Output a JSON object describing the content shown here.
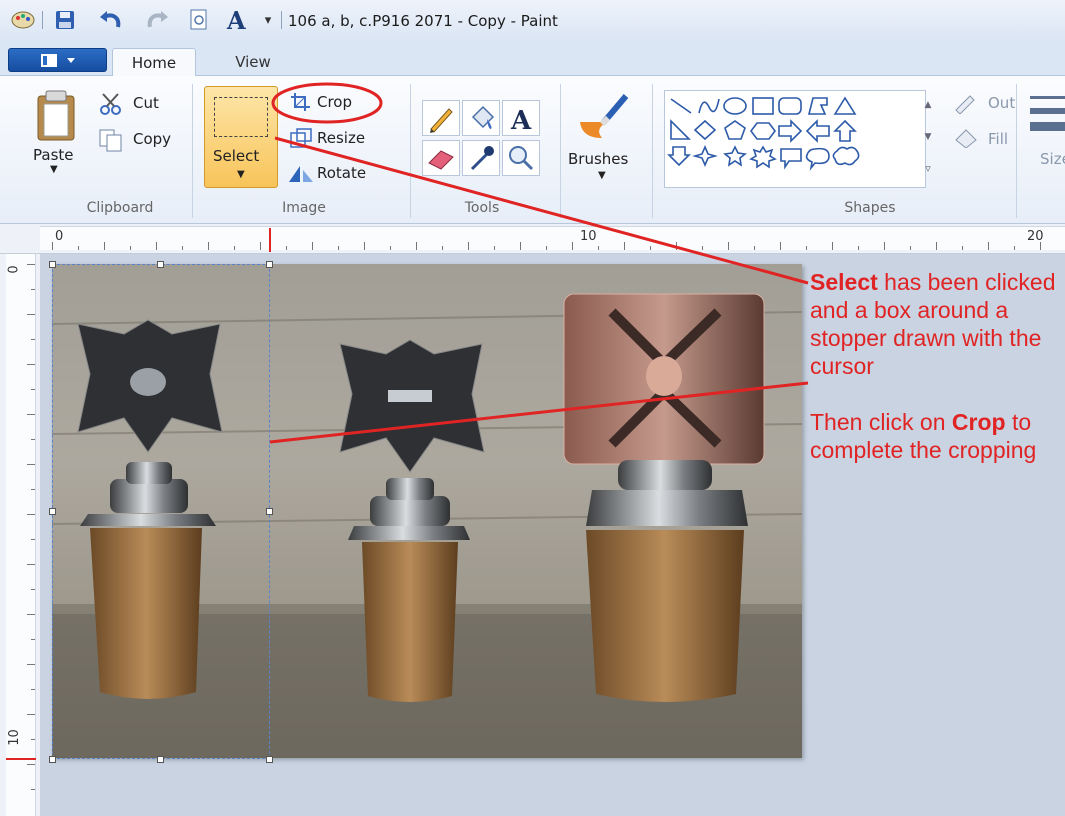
{
  "window": {
    "title": "106 a, b, c.P916 2071 - Copy - Paint"
  },
  "tabs": [
    {
      "label": "Home"
    },
    {
      "label": "View"
    }
  ],
  "clipboard": {
    "paste": "Paste",
    "cut": "Cut",
    "copy": "Copy",
    "group": "Clipboard"
  },
  "image": {
    "select": "Select",
    "crop": "Crop",
    "resize": "Resize",
    "rotate": "Rotate",
    "group": "Image"
  },
  "tools": {
    "group": "Tools"
  },
  "brushes": {
    "label": "Brushes"
  },
  "shapes": {
    "group": "Shapes",
    "outline": "Out",
    "fill": "Fill"
  },
  "size": {
    "label": "Size"
  },
  "ruler": {
    "h_labels": [
      "0",
      "10",
      "20"
    ],
    "v_labels": [
      "0",
      "10"
    ]
  },
  "annotation": {
    "line1_bold": "Select",
    "line1_rest": " has been clicked and a box around a stopper drawn with the cursor",
    "line2_pre": "Then click on ",
    "line2_bold": "Crop",
    "line2_rest": " to complete the cropping"
  },
  "colors": {
    "annotation": "#e02424",
    "ribbon_bg": "#f3f6fb",
    "selected_button": "#fbd27a"
  }
}
